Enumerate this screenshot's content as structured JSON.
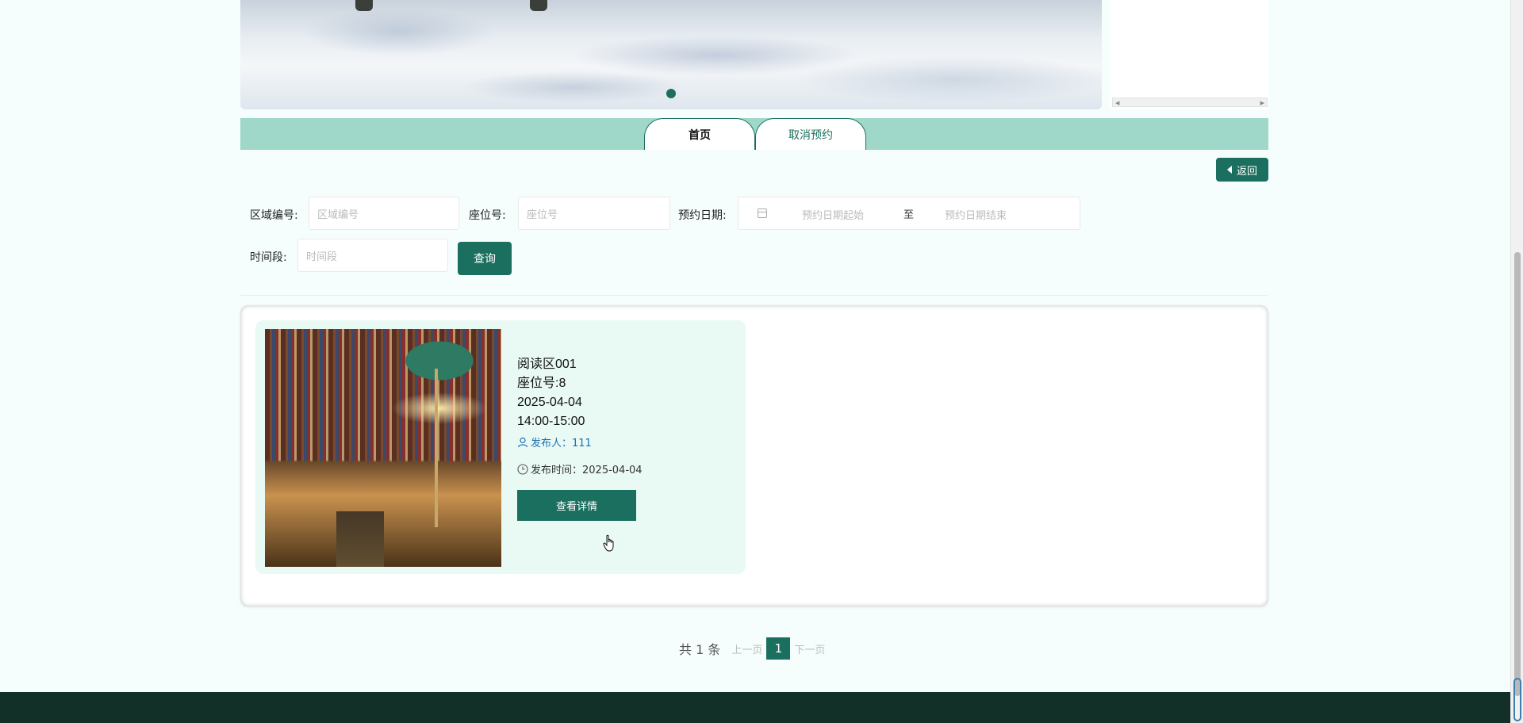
{
  "nav": {
    "tabs": [
      {
        "label": "首页"
      },
      {
        "label": "取消预约"
      }
    ],
    "back_label": "返回"
  },
  "search": {
    "area_label": "区域编号:",
    "area_placeholder": "区域编号",
    "seat_label": "座位号:",
    "seat_placeholder": "座位号",
    "date_label": "预约日期:",
    "date_start_placeholder": "预约日期起始",
    "date_sep": "至",
    "date_end_placeholder": "预约日期结束",
    "time_label": "时间段:",
    "time_placeholder": "时间段",
    "query_label": "查询"
  },
  "results": [
    {
      "area": "阅读区001",
      "seat": "座位号:8",
      "date": "2025-04-04",
      "time": "14:00-15:00",
      "publisher": "发布人：111",
      "publish_time": "发布时间：2025-04-04",
      "detail_label": "查看详情"
    }
  ],
  "pagination": {
    "total": "共 1 条",
    "prev": "上一页",
    "current": "1",
    "next": "下一页"
  },
  "colors": {
    "primary": "#1b6f5e",
    "nav_bg": "#9fd8c9",
    "card_bg": "#e9faf5",
    "footer": "#123028"
  },
  "icons": {
    "publisher": "user-icon",
    "publish_time": "clock-icon",
    "date": "calendar-icon",
    "back": "caret-left-icon"
  }
}
